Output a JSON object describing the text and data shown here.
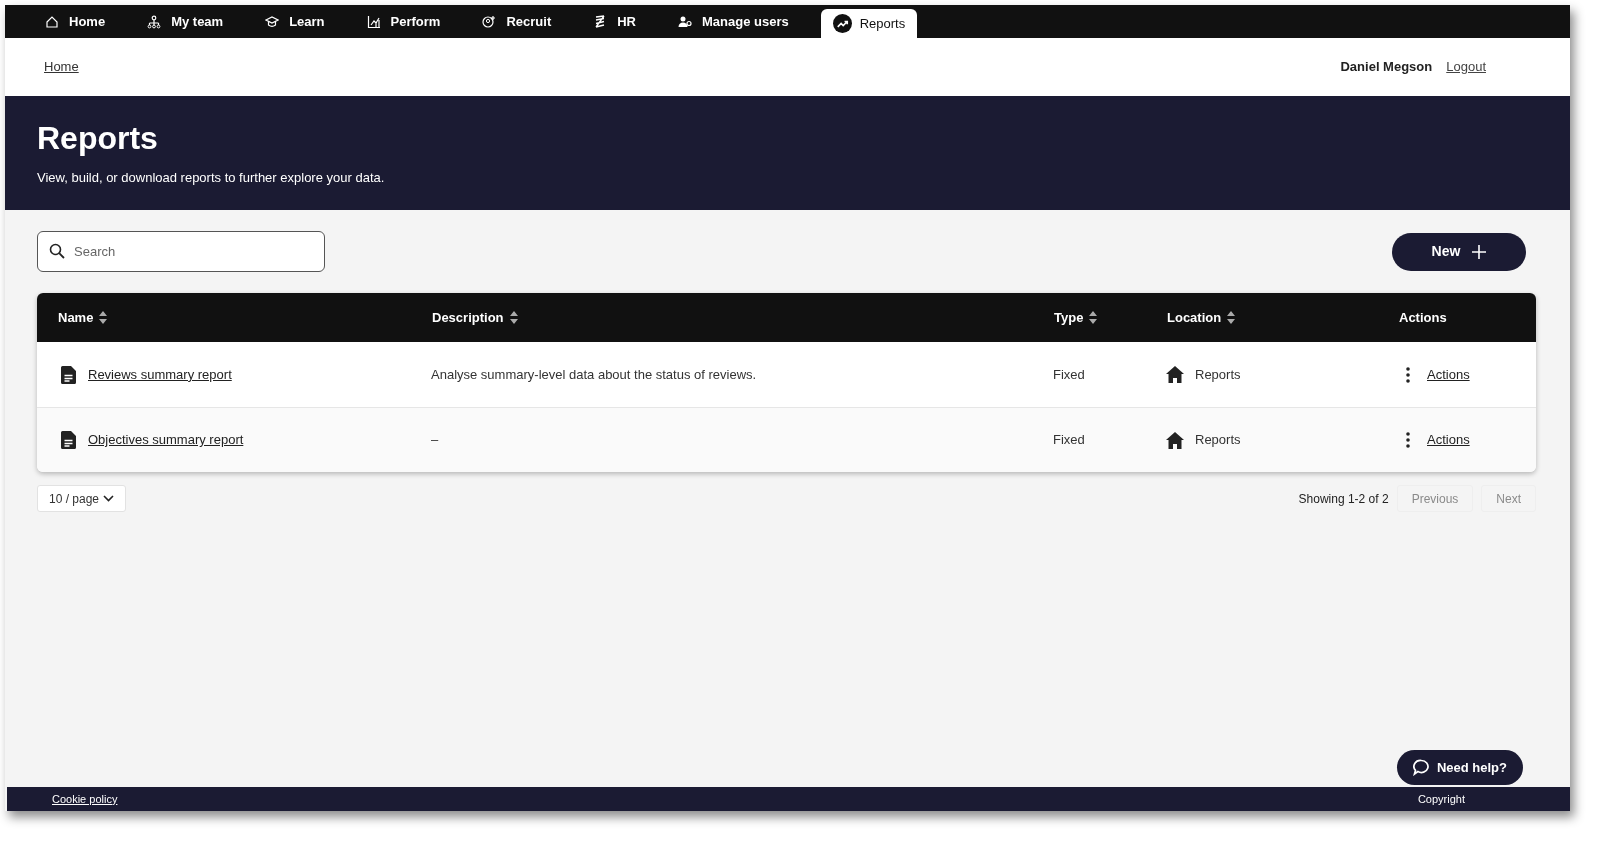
{
  "nav": {
    "items": [
      {
        "label": "Home",
        "selected": false
      },
      {
        "label": "My team",
        "selected": false
      },
      {
        "label": "Learn",
        "selected": false
      },
      {
        "label": "Perform",
        "selected": false
      },
      {
        "label": "Recruit",
        "selected": false
      },
      {
        "label": "HR",
        "selected": false
      },
      {
        "label": "Manage users",
        "selected": false
      },
      {
        "label": "Reports",
        "selected": true
      }
    ]
  },
  "breadcrumb": "Home",
  "user": {
    "name": "Daniel Megson",
    "logout": "Logout"
  },
  "hero": {
    "title": "Reports",
    "subtitle": "View, build, or download reports to further explore your data."
  },
  "search": {
    "placeholder": "Search"
  },
  "new_button": "New",
  "table": {
    "columns": [
      {
        "label": "Name",
        "sortable": true
      },
      {
        "label": "Description",
        "sortable": true
      },
      {
        "label": "Type",
        "sortable": true
      },
      {
        "label": "Location",
        "sortable": true
      },
      {
        "label": "Actions",
        "sortable": false
      }
    ],
    "rows": [
      {
        "name": "Reviews summary report",
        "description": "Analyse summary-level data about the status of reviews.",
        "type": "Fixed",
        "location": "Reports",
        "actions": "Actions"
      },
      {
        "name": "Objectives summary report",
        "description": "–",
        "type": "Fixed",
        "location": "Reports",
        "actions": "Actions"
      }
    ]
  },
  "pagination": {
    "page_size": "10 / page",
    "showing": "Showing 1-2 of 2",
    "previous": {
      "label": "Previous",
      "disabled": true
    },
    "next": {
      "label": "Next",
      "disabled": true
    }
  },
  "footer": {
    "cookie": "Cookie policy",
    "copyright": "Copyright"
  },
  "help_button": "Need help?"
}
